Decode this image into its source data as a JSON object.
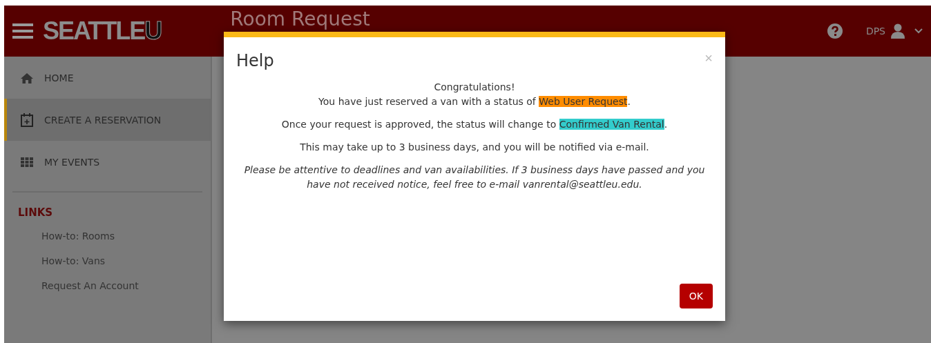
{
  "header": {
    "logo": "SEATTLE",
    "logo_end": "U",
    "title": "Room Request",
    "user": "DPS"
  },
  "nav": [
    {
      "label": "HOME",
      "kind": "home",
      "selected": false
    },
    {
      "label": "CREATE A RESERVATION",
      "kind": "create",
      "selected": true
    },
    {
      "label": "MY EVENTS",
      "kind": "events",
      "selected": false
    }
  ],
  "links": {
    "heading": "LINKS",
    "items": [
      "How-to: Rooms",
      "How-to: Vans",
      "Request An Account"
    ]
  },
  "dialog": {
    "title": "Help",
    "close": "×",
    "paragraphs": [
      {
        "italic": false,
        "lines": [
          [
            {
              "text": "Congratulations!"
            }
          ],
          [
            {
              "text": "You have just reserved a van with a status of "
            },
            {
              "text": "Web User Request",
              "color": "#ff8c00"
            },
            {
              "text": "."
            }
          ]
        ]
      },
      {
        "italic": false,
        "lines": [
          [
            {
              "text": "Once your request is approved, the status will change to "
            },
            {
              "text": "Confirmed Van Rental",
              "color": "#33cccc"
            },
            {
              "text": "."
            }
          ]
        ]
      },
      {
        "italic": false,
        "lines": [
          [
            {
              "text": "This may take up to 3 business days, and you will be notified via e-mail."
            }
          ]
        ]
      },
      {
        "italic": true,
        "lines": [
          [
            {
              "text": "Please be attentive to deadlines and van availabilities. If 3 business days have passed and you have not received notice, feel free to e-mail vanrental@seattleu.edu."
            }
          ]
        ]
      }
    ],
    "ok": "OK"
  }
}
